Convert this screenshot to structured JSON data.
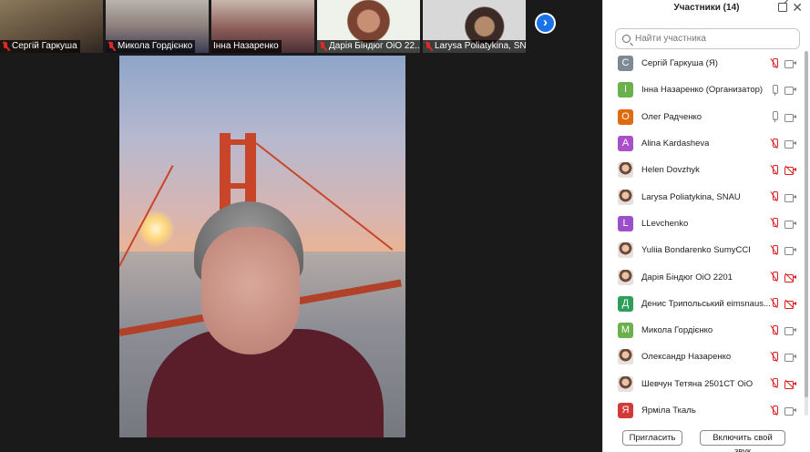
{
  "thumbnails": [
    {
      "name": "Сергій Гаркуша",
      "muted": true,
      "bg": "#6b5b45"
    },
    {
      "name": "Микола Гордієнко",
      "muted": true,
      "bg": "#7e7a78"
    },
    {
      "name": "Інна Назаренко",
      "muted": false,
      "bg": "#a08a84"
    },
    {
      "name": "Дарія Біндюг ОіО 22...",
      "muted": true,
      "bg": "#dfe8d8"
    },
    {
      "name": "Larysa Poliatykina, SN...",
      "muted": true,
      "bg": "#cfcfcf"
    }
  ],
  "next_button": "›",
  "panel": {
    "title": "Участники (14)",
    "search_placeholder": "Найти участника",
    "participants": [
      {
        "name": "Сергій Гаркуша (Я)",
        "avatar": "С",
        "avatar_color": "#7d8a95",
        "photo": false,
        "mic": "off",
        "cam": "on"
      },
      {
        "name": "Інна Назаренко (Организатор)",
        "avatar": "І",
        "avatar_color": "#6ab04c",
        "photo": false,
        "mic": "on",
        "cam": "on"
      },
      {
        "name": "Олег Радченко",
        "avatar": "О",
        "avatar_color": "#e06a10",
        "photo": false,
        "mic": "on",
        "cam": "on"
      },
      {
        "name": "Alina Kardasheva",
        "avatar": "A",
        "avatar_color": "#a84fc9",
        "photo": false,
        "mic": "off",
        "cam": "on"
      },
      {
        "name": "Helen Dovzhyk",
        "avatar": "",
        "avatar_color": "#e8e0dc",
        "photo": true,
        "mic": "off",
        "cam": "off"
      },
      {
        "name": "Larysa Poliatykina, SNAU",
        "avatar": "",
        "avatar_color": "#e8e0dc",
        "photo": true,
        "mic": "off",
        "cam": "on"
      },
      {
        "name": "LLevchenko",
        "avatar": "L",
        "avatar_color": "#9b4fc9",
        "photo": false,
        "mic": "off",
        "cam": "on"
      },
      {
        "name": "Yuliia Bondarenko SumyCCI",
        "avatar": "",
        "avatar_color": "#e8e0dc",
        "photo": true,
        "mic": "off",
        "cam": "on"
      },
      {
        "name": "Дарія Біндюг ОіО 2201",
        "avatar": "",
        "avatar_color": "#e8e0dc",
        "photo": true,
        "mic": "off",
        "cam": "off"
      },
      {
        "name": "Денис Трипольський eimsnaus...",
        "avatar": "Д",
        "avatar_color": "#2e9e5b",
        "photo": false,
        "mic": "off",
        "cam": "off"
      },
      {
        "name": "Микола Гордієнко",
        "avatar": "М",
        "avatar_color": "#6ab04c",
        "photo": false,
        "mic": "off",
        "cam": "on"
      },
      {
        "name": "Олександр Назаренко",
        "avatar": "",
        "avatar_color": "#e8e0dc",
        "photo": true,
        "mic": "off",
        "cam": "on"
      },
      {
        "name": "Шевчун Тетяна 2501СТ ОіО",
        "avatar": "",
        "avatar_color": "#e8e0dc",
        "photo": true,
        "mic": "off",
        "cam": "off"
      },
      {
        "name": "Ярміла Ткаль",
        "avatar": "Я",
        "avatar_color": "#d23a3a",
        "photo": false,
        "mic": "off",
        "cam": "on"
      }
    ],
    "invite_label": "Пригласить",
    "unmute_label": "Включить свой звук"
  }
}
